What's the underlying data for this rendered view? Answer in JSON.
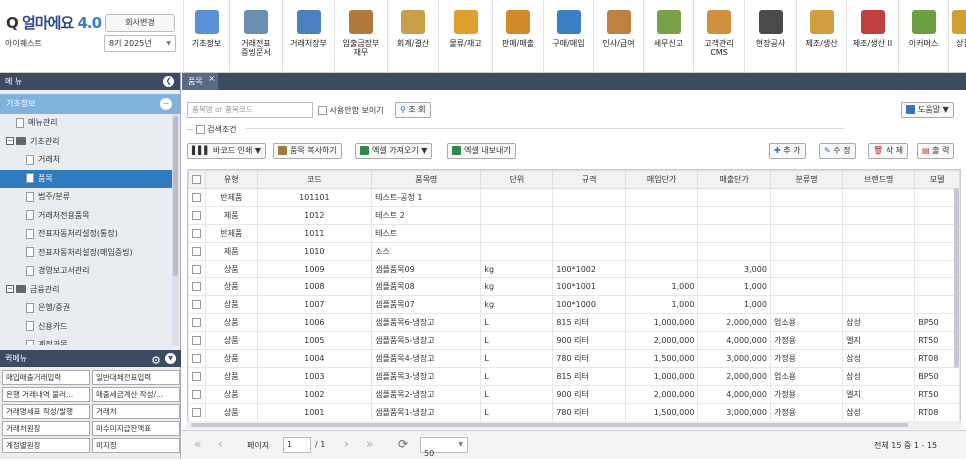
{
  "header": {
    "logo": "얼마에요",
    "version": "4.0",
    "company": "아이퀘스트",
    "change_company_label": "회사변경",
    "period": "8기 2025년"
  },
  "top_menu": [
    {
      "label": "기초정보",
      "icon": "basic-info-icon",
      "color": "#5b8fd6"
    },
    {
      "label": "거래전표\n증빙문서",
      "icon": "voucher-icon",
      "color": "#6a8fb0"
    },
    {
      "label": "거래처장부",
      "icon": "ledger-icon",
      "color": "#4a7fc0"
    },
    {
      "label": "입출금장부\n재무",
      "icon": "money-bag-icon",
      "color": "#b07a3a"
    },
    {
      "label": "회계/결산",
      "icon": "accounting-icon",
      "color": "#c9a04a"
    },
    {
      "label": "물류/재고",
      "icon": "forklift-icon",
      "color": "#e0a030"
    },
    {
      "label": "판매/매출",
      "icon": "sales-icon",
      "color": "#d08a2a"
    },
    {
      "label": "구매/매입",
      "icon": "purchase-icon",
      "color": "#3a80c8"
    },
    {
      "label": "인사/급여",
      "icon": "hr-icon",
      "color": "#c08040"
    },
    {
      "label": "세무신고",
      "icon": "tax-icon",
      "color": "#7aa04a"
    },
    {
      "label": "고객관리\nCMS",
      "icon": "customer-icon",
      "color": "#d09040"
    },
    {
      "label": "현장공사",
      "icon": "construction-icon",
      "color": "#4a4a4a"
    },
    {
      "label": "제조/생산",
      "icon": "manufacture-icon",
      "color": "#d0a040"
    },
    {
      "label": "제조/생산 II",
      "icon": "factory-icon",
      "color": "#c04040"
    },
    {
      "label": "이커머스",
      "icon": "shop-icon",
      "color": "#6aa040"
    },
    {
      "label": "상점",
      "icon": "store-icon",
      "color": "#d0a030"
    }
  ],
  "sidebar": {
    "title": "메 뉴",
    "category": "기초정보",
    "tree": [
      {
        "label": "메뉴관리",
        "level": 1,
        "type": "doc"
      },
      {
        "label": "기초관리",
        "level": 0,
        "type": "folder"
      },
      {
        "label": "거래처",
        "level": 2,
        "type": "doc"
      },
      {
        "label": "품목",
        "level": 2,
        "type": "doc",
        "selected": true
      },
      {
        "label": "범주/분류",
        "level": 2,
        "type": "doc"
      },
      {
        "label": "거래처전용품목",
        "level": 2,
        "type": "doc"
      },
      {
        "label": "전표자동처리설정(통장)",
        "level": 2,
        "type": "doc"
      },
      {
        "label": "전표자동처리설정(매입증빙)",
        "level": 2,
        "type": "doc"
      },
      {
        "label": "경영보고서관리",
        "level": 2,
        "type": "doc"
      },
      {
        "label": "금융관리",
        "level": 0,
        "type": "folder"
      },
      {
        "label": "은행/증권",
        "level": 2,
        "type": "doc"
      },
      {
        "label": "신용카드",
        "level": 2,
        "type": "doc"
      },
      {
        "label": "계정과목",
        "level": 2,
        "type": "doc"
      }
    ],
    "quick_title": "퀵메뉴",
    "quick": [
      "매입매출거래입력",
      "일반대체전표입력",
      "은행 거래내역 불러...",
      "매출세금계산 작성/...",
      "거래명세표 작성/발행",
      "거래처",
      "거래처원장",
      "미수미지급잔액표",
      "계정별원장",
      "미지정"
    ]
  },
  "tab": {
    "label": "품목"
  },
  "toolbar": {
    "search_placeholder": "품목명 or 품목코드",
    "show_unused": "사용안함 보이기",
    "search_btn": "조 회",
    "help": "도움말",
    "cond": "검색조건",
    "barcode": "바코드 인쇄",
    "copy": "품목 복사하기",
    "excel_import": "엑셀 가져오기",
    "excel_export": "엑셀 내보내기",
    "add": "추 가",
    "edit": "수 정",
    "delete": "삭 제",
    "print": "출 력"
  },
  "table": {
    "headers": [
      "유형",
      "코드",
      "품목명",
      "단위",
      "규격",
      "매입단가",
      "매출단가",
      "분류명",
      "브랜드명",
      "모델"
    ],
    "rows": [
      [
        "반제품",
        "101101",
        "테스트-공정 1",
        "",
        "",
        "",
        "",
        "",
        "",
        ""
      ],
      [
        "제품",
        "1012",
        "테스트 2",
        "",
        "",
        "",
        "",
        "",
        "",
        ""
      ],
      [
        "반제품",
        "1011",
        "테스트",
        "",
        "",
        "",
        "",
        "",
        "",
        ""
      ],
      [
        "제품",
        "1010",
        "소스",
        "",
        "",
        "",
        "",
        "",
        "",
        ""
      ],
      [
        "상품",
        "1009",
        "샘플품목09",
        "kg",
        "100*1002",
        "",
        "3,000",
        "",
        "",
        ""
      ],
      [
        "상품",
        "1008",
        "샘플품목08",
        "kg",
        "100*1001",
        "1,000",
        "1,000",
        "",
        "",
        ""
      ],
      [
        "상품",
        "1007",
        "샘플품목07",
        "kg",
        "100*1000",
        "1,000",
        "1,000",
        "",
        "",
        ""
      ],
      [
        "상품",
        "1006",
        "샘플품목6-냉장고",
        "L",
        "815 리터",
        "1,000,000",
        "2,000,000",
        "업소용",
        "삼성",
        "BP50"
      ],
      [
        "상품",
        "1005",
        "샘플품목5-냉장고",
        "L",
        "900 리터",
        "2,000,000",
        "4,000,000",
        "가정용",
        "엘지",
        "RT50"
      ],
      [
        "상품",
        "1004",
        "샘플품목4-냉장고",
        "L",
        "780 리터",
        "1,500,000",
        "3,000,000",
        "가정용",
        "삼성",
        "RT08"
      ],
      [
        "상품",
        "1003",
        "샘플품목3-냉장고",
        "L",
        "815 리터",
        "1,000,000",
        "2,000,000",
        "업소용",
        "삼성",
        "BP50"
      ],
      [
        "상품",
        "1002",
        "샘플품목2-냉장고",
        "L",
        "900 리터",
        "2,000,000",
        "4,000,000",
        "가정용",
        "엘지",
        "RT50"
      ],
      [
        "상품",
        "1001",
        "샘플품목1-냉장고",
        "L",
        "780 리터",
        "1,500,000",
        "3,000,000",
        "가정용",
        "삼성",
        "RT08"
      ]
    ]
  },
  "pager": {
    "page_label": "페이지",
    "page": "1",
    "total_pages": "/ 1",
    "page_size": "50",
    "summary": "전체 15 중 1 - 15"
  }
}
